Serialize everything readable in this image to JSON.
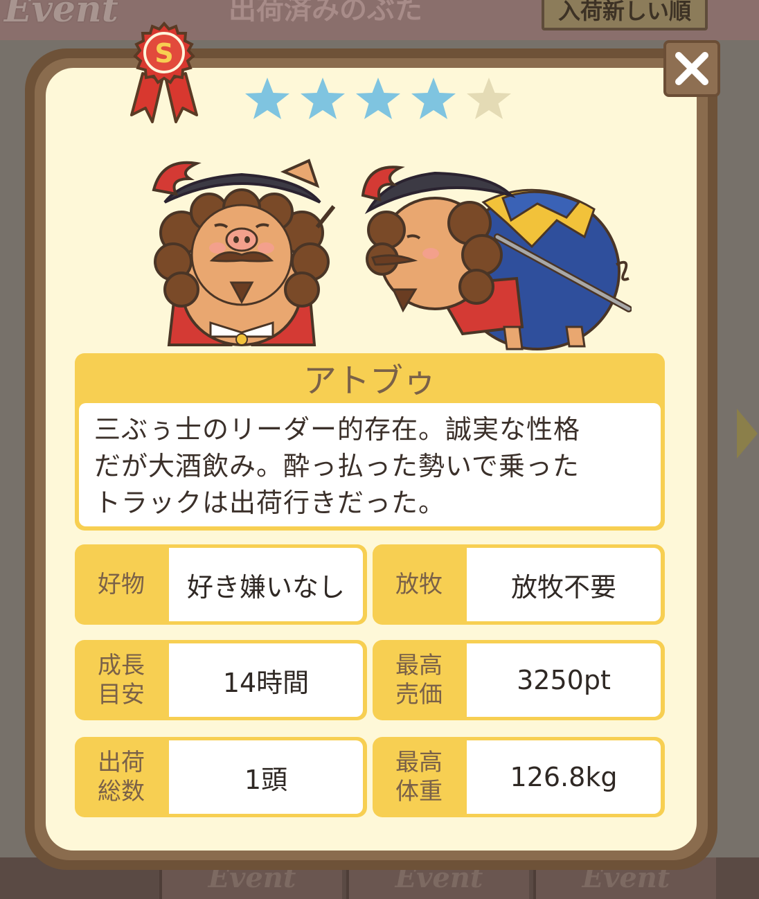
{
  "background": {
    "event_tag": "Event",
    "title": "出荷済みのぶた",
    "sort_button": "入荷新しい順",
    "bottom_tabs": [
      "Event",
      "Event",
      "Event"
    ]
  },
  "modal": {
    "rank": "S",
    "rating": {
      "value": 4,
      "max": 5
    },
    "name": "アトブゥ",
    "description": "三ぶぅ士のリーダー的存在。誠実な性格\nだが大酒飲み。酔っ払った勢いで乗った\nトラックは出荷行きだった。",
    "stats": [
      {
        "label": "好物",
        "value": "好き嫌いなし"
      },
      {
        "label": "放牧",
        "value": "放牧不要"
      },
      {
        "label": "成長\n目安",
        "value": "14時間"
      },
      {
        "label": "最高\n売価",
        "value": "3250pt"
      },
      {
        "label": "出荷\n総数",
        "value": "1頭"
      },
      {
        "label": "最高\n体重",
        "value": "126.8kg"
      }
    ],
    "close_icon": "close-icon"
  },
  "colors": {
    "card_bg": "#fef8d8",
    "accent_yellow": "#f7cf52",
    "frame_brown": "#6e5238",
    "star_filled": "#7fc4e0",
    "star_empty": "#e4dbb5",
    "ribbon_red": "#d8382f"
  }
}
